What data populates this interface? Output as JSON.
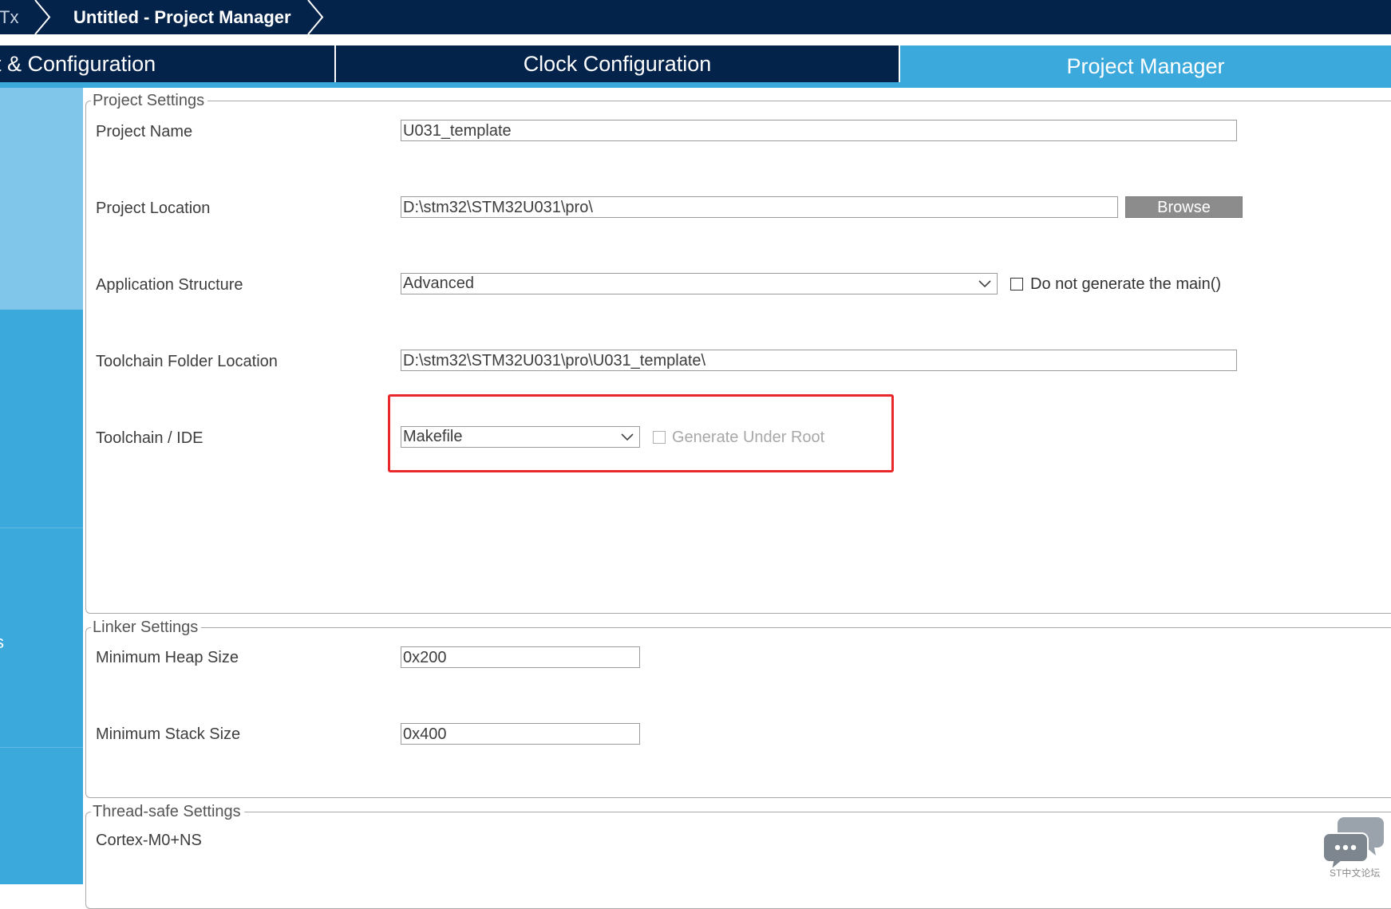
{
  "breadcrumb": {
    "previous": "Tx",
    "current": "Untitled - Project Manager"
  },
  "tabs": {
    "pinout": "t & Configuration",
    "clock": "Clock Configuration",
    "project_manager": "Project Manager"
  },
  "sidebar": {
    "item3_partial": "s"
  },
  "project_settings": {
    "legend": "Project Settings",
    "project_name_label": "Project Name",
    "project_name_value": "U031_template",
    "project_location_label": "Project Location",
    "project_location_value": "D:\\stm32\\STM32U031\\pro\\",
    "browse_label": "Browse",
    "app_structure_label": "Application Structure",
    "app_structure_value": "Advanced",
    "no_main_label": "Do not generate the main()",
    "toolchain_folder_label": "Toolchain Folder Location",
    "toolchain_folder_value": "D:\\stm32\\STM32U031\\pro\\U031_template\\",
    "toolchain_ide_label": "Toolchain / IDE",
    "toolchain_ide_value": "Makefile",
    "generate_under_root_label": "Generate Under Root"
  },
  "linker_settings": {
    "legend": "Linker Settings",
    "heap_label": "Minimum Heap Size",
    "heap_value": "0x200",
    "stack_label": "Minimum Stack Size",
    "stack_value": "0x400"
  },
  "thread_safe_settings": {
    "legend": "Thread-safe Settings",
    "core_label": "Cortex-M0+NS"
  },
  "watermark": {
    "text": "ST中文论坛"
  },
  "colors": {
    "header_dark": "#03234b",
    "accent_blue": "#3ca9dc",
    "sidebar_light": "#7fc6ea",
    "highlight_red": "#e8282b",
    "button_gray": "#8c8c8c"
  },
  "icons": [
    "chevron-right-icon",
    "chevron-down-icon",
    "chat-bubble-icon"
  ]
}
